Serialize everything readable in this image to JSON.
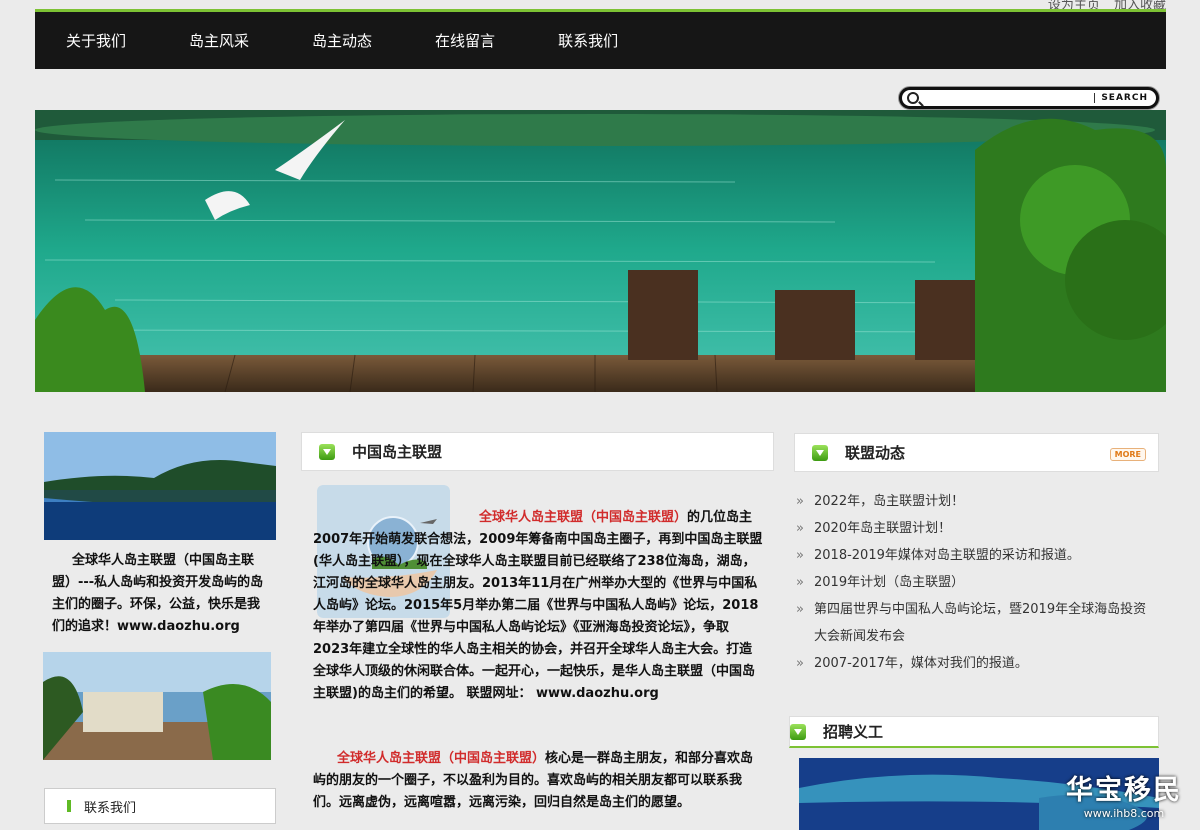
{
  "top_links": [
    "设为主页",
    "加入收藏"
  ],
  "nav": [
    "关于我们",
    "岛主风采",
    "岛主动态",
    "在线留言",
    "联系我们"
  ],
  "search": {
    "placeholder": "",
    "button": "SEARCH"
  },
  "left": {
    "intro_text": "全球华人岛主联盟（中国岛主联盟）---私人岛屿和投资开发岛屿的岛主们的圈子。环保，公益，快乐是我们的追求！www.daozhu.org",
    "contact_title": "联系我们"
  },
  "middle": {
    "title": "中国岛主联盟",
    "para1_red": "全球华人岛主联盟（中国岛主联盟）",
    "para1_rest": "的几位岛主2007年开始萌发联合想法，2009年筹备南中国岛主圈子，再到中国岛主联盟(华人岛主联盟），现在全球华人岛主联盟目前已经联络了238位海岛，湖岛，江河岛的全球华人岛主朋友。2013年11月在广州举办大型的《世界与中国私人岛屿》论坛。2015年5月举办第二届《世界与中国私人岛屿》论坛，2018年举办了第四届《世界与中国私人岛屿论坛》《亚洲海岛投资论坛》，争取2023年建立全球性的华人岛主相关的协会，并召开全球华人岛主大会。打造全球华人顶级的休闲联合体。一起开心，一起快乐，是华人岛主联盟（中国岛主联盟)的岛主们的希望。 联盟网址： www.daozhu.org",
    "para2_red": "全球华人岛主联盟（中国岛主联盟）",
    "para2_rest": "核心是一群岛主朋友，和部分喜欢岛屿的朋友的一个圈子，不以盈利为目的。喜欢岛屿的相关朋友都可以联系我们。远离虚伪，远离喧嚣，远离污染，回归自然是岛主们的愿望。"
  },
  "right": {
    "news_title": "联盟动态",
    "more": "MORE",
    "news": [
      "2022年，岛主联盟计划！",
      "2020年岛主联盟计划！",
      "2018-2019年媒体对岛主联盟的采访和报道。",
      "2019年计划（岛主联盟）",
      "第四届世界与中国私人岛屿论坛，暨2019年全球海岛投资大会新闻发布会",
      "2007-2017年，媒体对我们的报道。"
    ],
    "volunteer_title": "招聘义工"
  },
  "watermark": {
    "big": "华宝移民",
    "small": "www.ihb8.com"
  },
  "colors": {
    "nav_bg": "#161616",
    "accent_green": "#7dc234",
    "highlight_red": "#d12b2b"
  }
}
